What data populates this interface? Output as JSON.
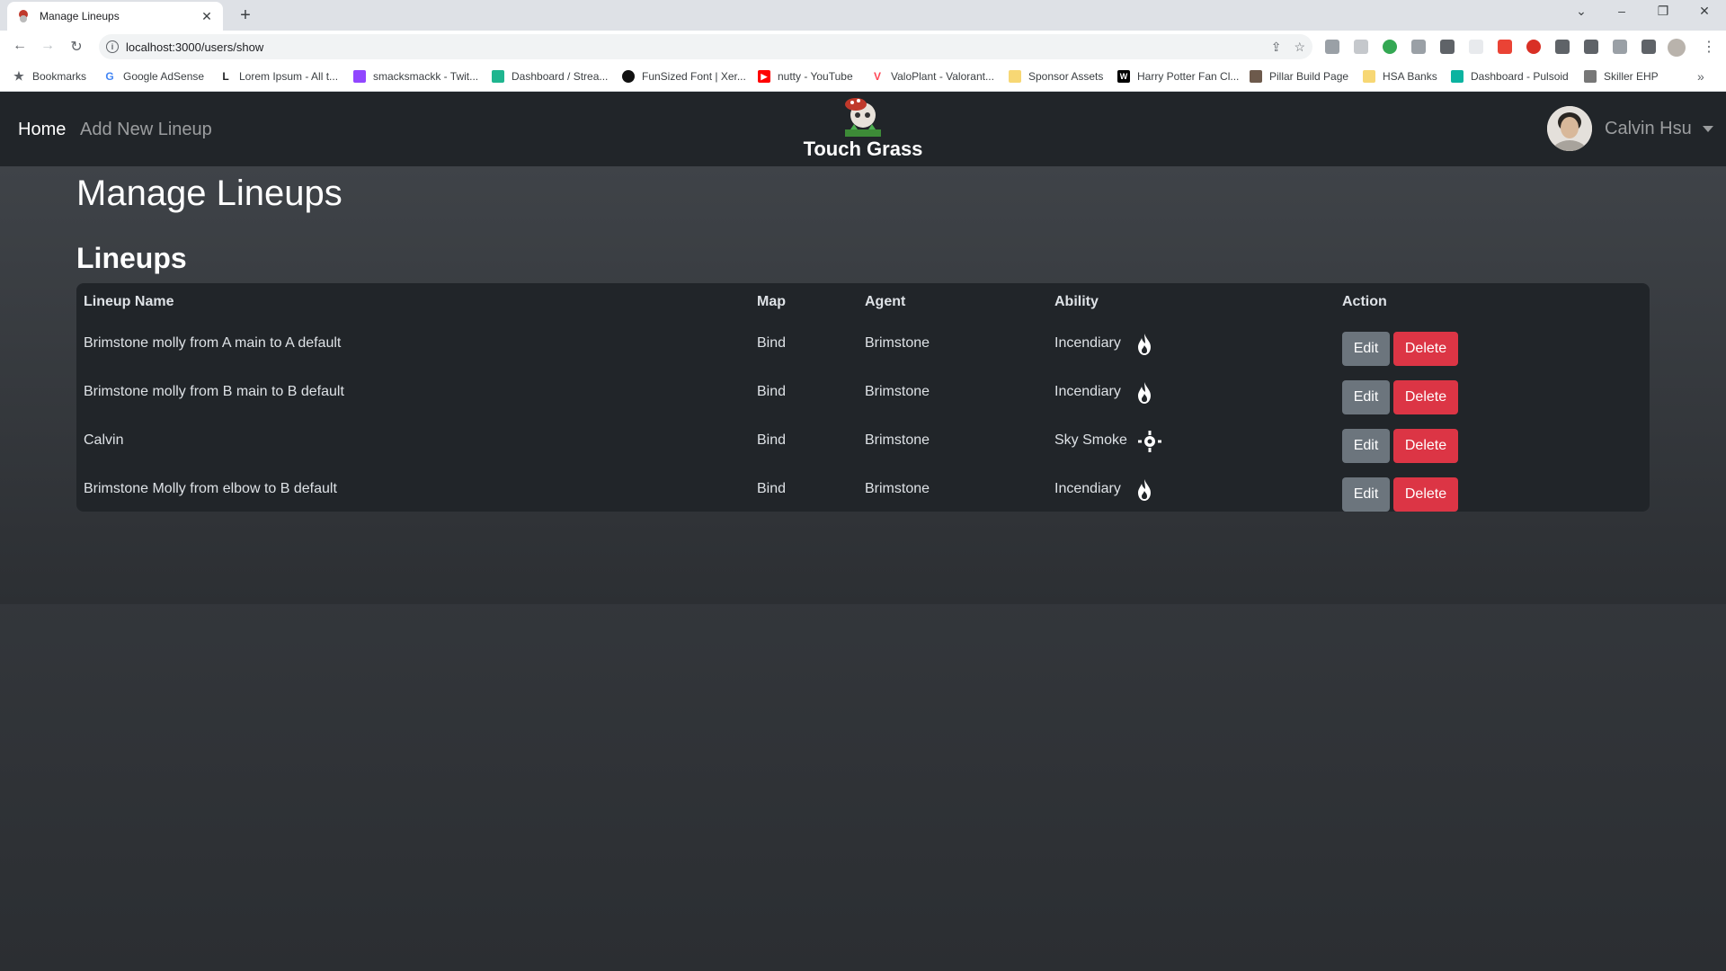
{
  "browser": {
    "tab_title": "Manage Lineups",
    "url": "localhost:3000/users/show",
    "bookmarks": [
      {
        "label": "Bookmarks",
        "color": "#5f6368"
      },
      {
        "label": "Google AdSense",
        "color": "#4285f4"
      },
      {
        "label": "Lorem Ipsum - All t...",
        "color": "#202124"
      },
      {
        "label": "smacksmackk - Twit...",
        "color": "#9146ff"
      },
      {
        "label": "Dashboard / Strea...",
        "color": "#1fb58f"
      },
      {
        "label": "FunSized Font | Xer...",
        "color": "#111111"
      },
      {
        "label": "nutty - YouTube",
        "color": "#ff0000"
      },
      {
        "label": "ValoPlant - Valorant...",
        "color": "#ff4655"
      },
      {
        "label": "Sponsor Assets",
        "color": "#f7d774"
      },
      {
        "label": "Harry Potter Fan Cl...",
        "color": "#000000"
      },
      {
        "label": "Pillar Build Page",
        "color": "#6d5a4c"
      },
      {
        "label": "HSA Banks",
        "color": "#f7d774"
      },
      {
        "label": "Dashboard - Pulsoid",
        "color": "#0bb3a0"
      },
      {
        "label": "Skiller EHP",
        "color": "#777777"
      }
    ]
  },
  "nav": {
    "home": "Home",
    "add_lineup": "Add New Lineup",
    "brand": "Touch Grass",
    "user_name": "Calvin Hsu"
  },
  "main": {
    "title": "Manage Lineups",
    "section_title": "Lineups",
    "columns": [
      "Lineup Name",
      "Map",
      "Agent",
      "Ability",
      "Action"
    ],
    "rows": [
      {
        "name": "Brimstone molly from A main to A default",
        "map": "Bind",
        "agent": "Brimstone",
        "ability": "Incendiary",
        "icon": "flame-icon"
      },
      {
        "name": "Brimstone molly from B main to B default",
        "map": "Bind",
        "agent": "Brimstone",
        "ability": "Incendiary",
        "icon": "flame-icon"
      },
      {
        "name": "Calvin",
        "map": "Bind",
        "agent": "Brimstone",
        "ability": "Sky Smoke",
        "icon": "crosshair-icon"
      },
      {
        "name": "Brimstone Molly from elbow to B default",
        "map": "Bind",
        "agent": "Brimstone",
        "ability": "Incendiary",
        "icon": "flame-icon"
      }
    ],
    "edit_label": "Edit",
    "delete_label": "Delete"
  },
  "colors": {
    "navbar": "#212529",
    "edit": "#6c757d",
    "delete": "#dc3545"
  }
}
